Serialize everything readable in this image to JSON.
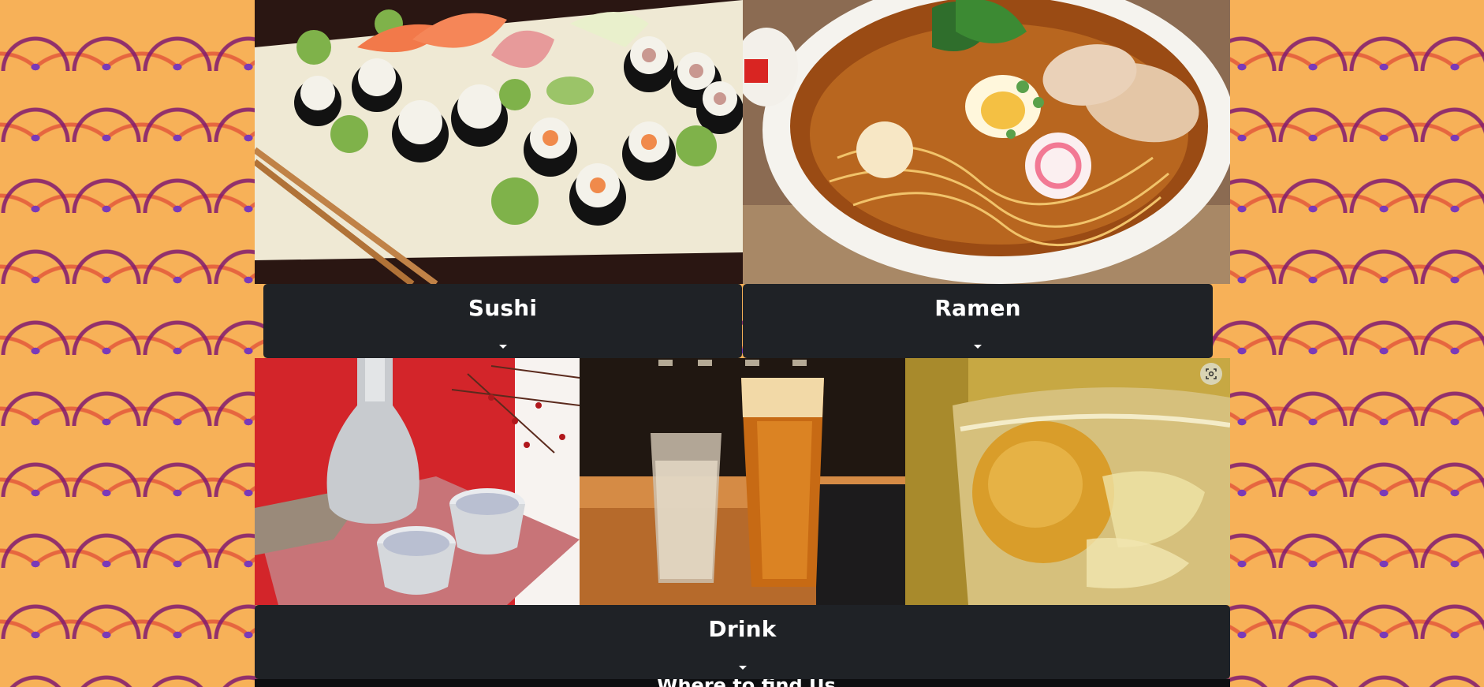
{
  "menu": {
    "sushi": {
      "title": "Sushi"
    },
    "ramen": {
      "title": "Ramen"
    },
    "drink": {
      "title": "Drink"
    }
  },
  "footer": {
    "partial_heading": "Where to find Us"
  },
  "icons": {
    "dropdown": "caret-down-icon",
    "lens": "visual-search-icon"
  },
  "colors": {
    "panel_bg": "#1f2226",
    "page_bg": "#f7b158",
    "pattern_purple": "#801a70",
    "pattern_red": "#e25438",
    "pattern_violet": "#7a3ab8"
  }
}
